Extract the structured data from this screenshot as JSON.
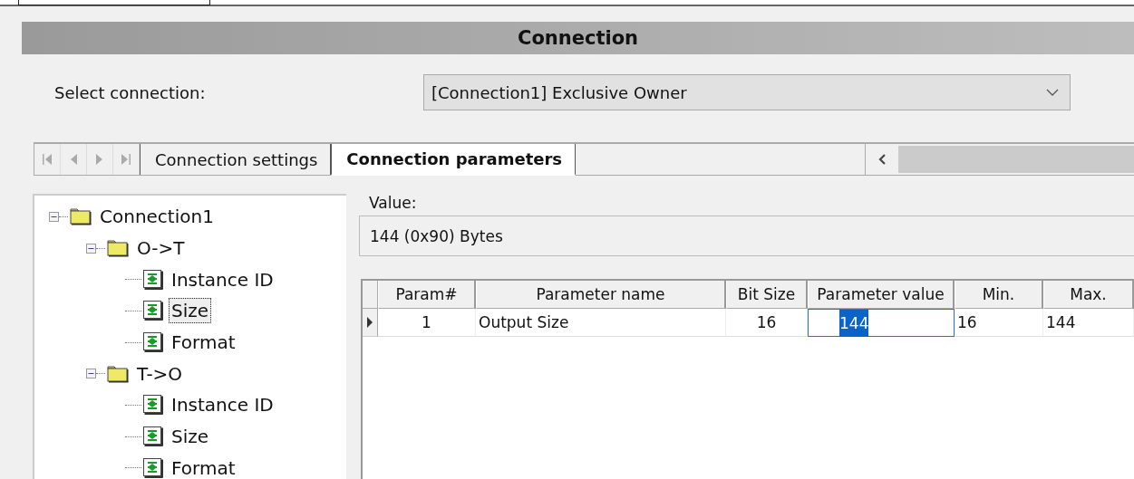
{
  "header": {
    "title": "Connection"
  },
  "select_connection": {
    "label": "Select connection:",
    "value": "[Connection1] Exclusive Owner"
  },
  "tabs": [
    {
      "label": "Connection settings",
      "selected": false
    },
    {
      "label": "Connection parameters",
      "selected": true
    }
  ],
  "tree": [
    {
      "label": "Connection1",
      "kind": "folder",
      "expanded": true,
      "selected": false,
      "children": [
        {
          "label": "O->T",
          "kind": "folder",
          "expanded": true,
          "selected": false,
          "children": [
            {
              "label": "Instance ID",
              "kind": "param",
              "selected": false
            },
            {
              "label": "Size",
              "kind": "param",
              "selected": true
            },
            {
              "label": "Format",
              "kind": "param",
              "selected": false
            }
          ]
        },
        {
          "label": "T->O",
          "kind": "folder",
          "expanded": true,
          "selected": false,
          "children": [
            {
              "label": "Instance ID",
              "kind": "param",
              "selected": false
            },
            {
              "label": "Size",
              "kind": "param",
              "selected": false
            },
            {
              "label": "Format",
              "kind": "param",
              "selected": false
            }
          ]
        }
      ]
    }
  ],
  "value": {
    "label": "Value:",
    "text": "144 (0x90) Bytes"
  },
  "table": {
    "columns": [
      "Param#",
      "Parameter name",
      "Bit Size",
      "Parameter value",
      "Min.",
      "Max."
    ],
    "rows": [
      {
        "selected": true,
        "cells": [
          {
            "text": "1",
            "editing": false
          },
          {
            "text": "Output Size",
            "editing": false
          },
          {
            "text": "16",
            "editing": false
          },
          {
            "text": "144",
            "editing": true
          },
          {
            "text": "16",
            "editing": false
          },
          {
            "text": "144",
            "editing": false
          }
        ]
      }
    ]
  }
}
